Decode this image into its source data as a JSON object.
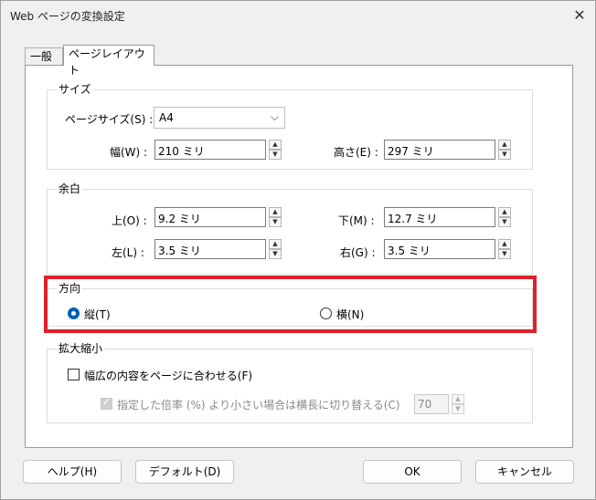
{
  "window": {
    "title": "Web ページの変換設定"
  },
  "tabs": [
    {
      "label": "一般"
    },
    {
      "label": "ページレイアウト"
    }
  ],
  "size_group": {
    "title": "サイズ",
    "page_size_label": "ページサイズ(S) :",
    "page_size_value": "A4",
    "width_label": "幅(W) :",
    "width_value": "210 ミリ",
    "height_label": "高さ(E) :",
    "height_value": "297 ミリ"
  },
  "margin_group": {
    "title": "余白",
    "top_label": "上(O) :",
    "top_value": "9.2 ミリ",
    "bottom_label": "下(M) :",
    "bottom_value": "12.7 ミリ",
    "left_label": "左(L) :",
    "left_value": "3.5 ミリ",
    "right_label": "右(G) :",
    "right_value": "3.5 ミリ"
  },
  "orientation_group": {
    "title": "方向",
    "portrait_label": "縦(T)",
    "landscape_label": "横(N)",
    "selected": "portrait"
  },
  "scale_group": {
    "title": "拡大縮小",
    "fit_label": "幅広の内容をページに合わせる(F)",
    "switch_label": "指定した倍率 (%) より小さい場合は横長に切り替える(C)",
    "percent_value": "70"
  },
  "buttons": {
    "help": "ヘルプ(H)",
    "default": "デフォルト(D)",
    "ok": "OK",
    "cancel": "キャンセル"
  },
  "colors": {
    "highlight": "#e0202a",
    "accent": "#005fb8"
  }
}
